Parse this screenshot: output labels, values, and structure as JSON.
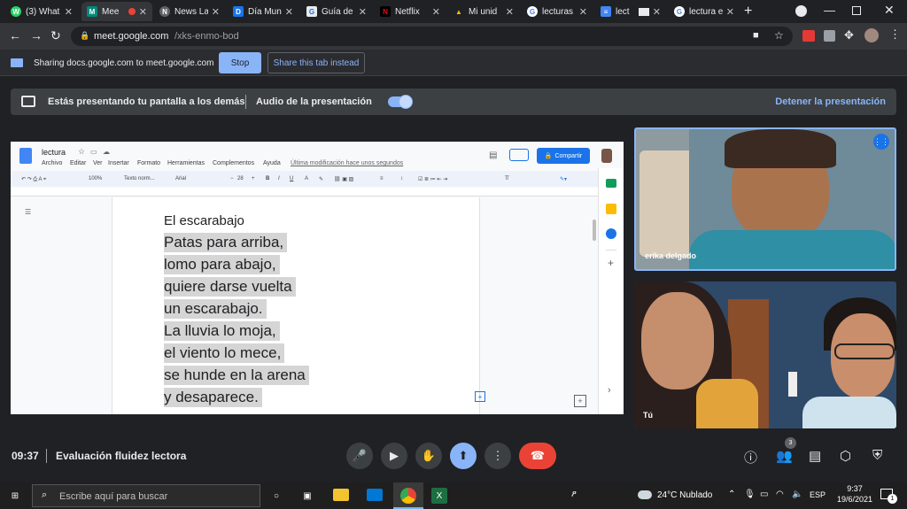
{
  "browser": {
    "tabs": [
      {
        "label": "(3) What",
        "fav_color": "#25d366",
        "fav_glyph": "W"
      },
      {
        "label": "Mee",
        "fav_color": "#00897b",
        "fav_glyph": "M"
      },
      {
        "label": "News La",
        "fav_color": "#5f6368",
        "fav_glyph": "N"
      },
      {
        "label": "Día Mun",
        "fav_color": "#1a73e8",
        "fav_glyph": "D"
      },
      {
        "label": "Guía de",
        "fav_color": "#e8eaed",
        "fav_glyph": "G"
      },
      {
        "label": "Netflix",
        "fav_color": "#e50914",
        "fav_glyph": "N"
      },
      {
        "label": "Mi unid",
        "fav_color": "#fbbc04",
        "fav_glyph": "▲"
      },
      {
        "label": "lecturas",
        "fav_color": "#4285f4",
        "fav_glyph": "G"
      },
      {
        "label": "lect",
        "fav_color": "#4285f4",
        "fav_glyph": "≡"
      },
      {
        "label": "lectura e",
        "fav_color": "#4285f4",
        "fav_glyph": "G"
      }
    ],
    "url_domain": "meet.google.com",
    "url_path": "/xks-enmo-bod"
  },
  "sharing": {
    "text": "Sharing docs.google.com to meet.google.com",
    "stop_label": "Stop",
    "share_tab_label": "Share this tab instead"
  },
  "meet": {
    "presenting_text": "Estás presentando tu pantalla a los demás",
    "audio_label": "Audio de la presentación",
    "stop_presenting_label": "Detener la presentación",
    "time": "09:37",
    "meeting_title": "Evaluación fluidez lectora",
    "participants_count": "3",
    "participants": [
      {
        "name": "erika delgado"
      },
      {
        "name": "Tú"
      }
    ]
  },
  "docs": {
    "doc_title": "lectura",
    "share_label": "Compartir",
    "menu": [
      "Archivo",
      "Editar",
      "Ver",
      "Insertar",
      "Formato",
      "Herramientas",
      "Complementos",
      "Ayuda"
    ],
    "last_edit": "Última modificación hace unos segundos",
    "toolbar": {
      "zoom": "100%",
      "style": "Texto norm...",
      "font": "Arial",
      "size": "28"
    },
    "lines": [
      "El escarabajo",
      "Patas para arriba,",
      "lomo para abajo,",
      "quiere darse vuelta",
      "un escarabajo.",
      "La lluvia lo moja,",
      "el viento lo mece,",
      "se hunde en la arena",
      "y desaparece."
    ]
  },
  "taskbar": {
    "search_placeholder": "Escribe aquí para buscar",
    "weather": "24°C  Nublado",
    "lang": "ESP",
    "clock_time": "9:37",
    "clock_date": "19/6/2021",
    "notif_count": "1"
  },
  "colors": {
    "accent": "#8ab4f8",
    "end_call": "#ea4335",
    "docs_blue": "#1a73e8"
  }
}
